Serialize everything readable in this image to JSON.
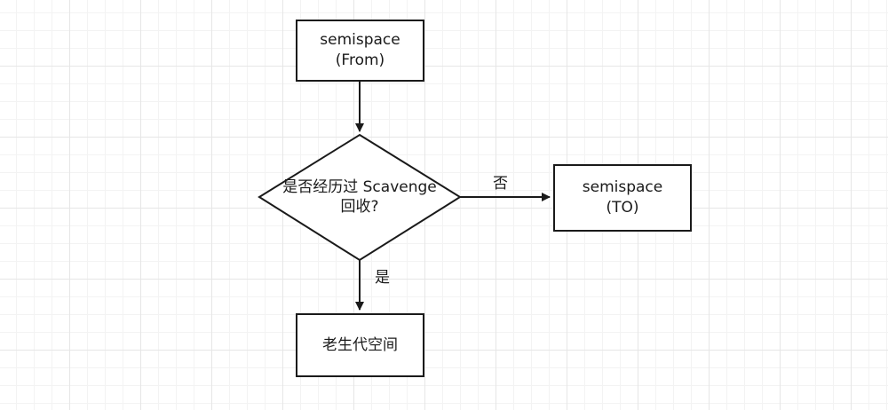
{
  "diagram": {
    "nodes": {
      "from": {
        "line1": "semispace",
        "line2": "(From)"
      },
      "decision": {
        "line1": "是否经历过 Scavenge",
        "line2": "回收?"
      },
      "to": {
        "line1": "semispace",
        "line2": "(TO)"
      },
      "old_generation": {
        "label": "老生代空间"
      }
    },
    "edges": {
      "no_label": "否",
      "yes_label": "是"
    }
  }
}
